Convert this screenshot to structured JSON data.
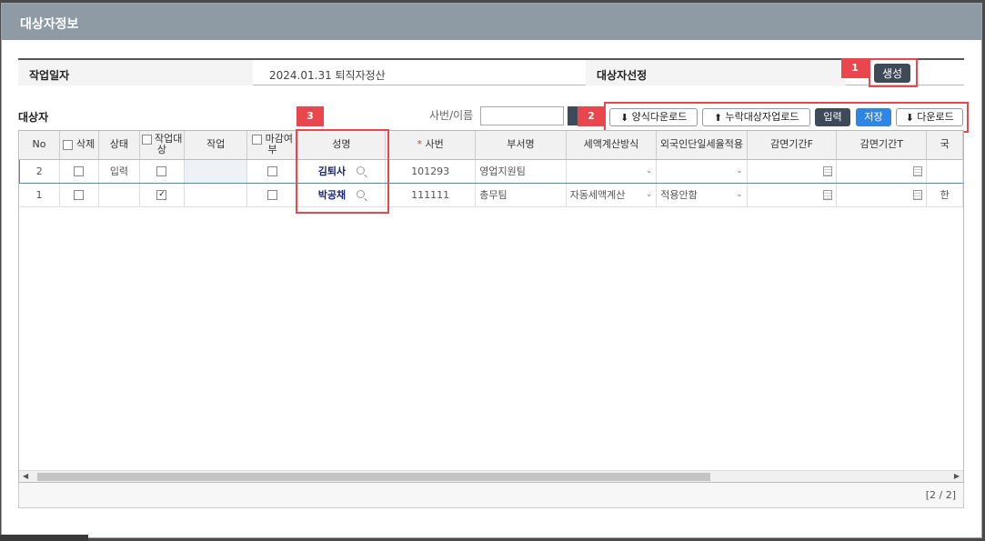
{
  "dialog": {
    "title": "대상자정보"
  },
  "info": {
    "work_date_label": "작업일자",
    "work_date_value": "2024.01.31 퇴직자정산",
    "target_select_label": "대상자선정",
    "create_button": "생성"
  },
  "section": {
    "title": "대상자",
    "search_label": "사번/이름",
    "search_value": ""
  },
  "toolbar": {
    "template_download": "양식다운로드",
    "missing_upload": "누락대상자업로드",
    "input": "입력",
    "save": "저장",
    "download": "다운로드"
  },
  "callouts": {
    "one": "1",
    "two": "2",
    "three": "3"
  },
  "columns": {
    "no": "No",
    "delete": "삭제",
    "status": "상태",
    "work_target": "작업대상",
    "work": "작업",
    "closed": "마감여부",
    "name": "성명",
    "emp_no": "사번",
    "dept": "부서명",
    "tax_method": "세액계산방식",
    "foreign_flat": "외국인단일세율적용",
    "reduction_from": "감면기간F",
    "reduction_to": "감면기간T",
    "extra": "국"
  },
  "rows": [
    {
      "no": "2",
      "status": "입력",
      "work_target": false,
      "name": "김퇴사",
      "emp_no": "101293",
      "dept": "영업지원팀",
      "tax_method": "",
      "foreign_flat": "",
      "extra": ""
    },
    {
      "no": "1",
      "status": "",
      "work_target": true,
      "name": "박공채",
      "emp_no": "111111",
      "dept": "총무팀",
      "tax_method": "자동세액계산",
      "foreign_flat": "적용안함",
      "extra": "한"
    }
  ],
  "pager": {
    "text": "[2 / 2]"
  },
  "colors": {
    "header": "#8e9ba4",
    "callout": "#e9474d",
    "primary": "#2f86e6",
    "dark_button": "#3f4a58"
  }
}
